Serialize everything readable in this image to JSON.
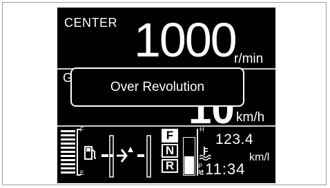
{
  "display": {
    "mode_label": "CENTER",
    "rpm_value": "1000",
    "rpm_unit": "r/min",
    "obscured_label_char": "G",
    "speed_value": "10",
    "speed_unit": "km/h",
    "fuel_full_label": "F",
    "fuel_empty_label": "E",
    "temp_hot_label": "H",
    "temp_cold_label": "C",
    "fuel_economy_value": "123.4",
    "fuel_economy_unit": "km/l",
    "clock_am": "A",
    "clock_pm": "P",
    "clock_m": "M",
    "clock_time": "11:34",
    "gears": [
      {
        "label": "F",
        "active": true
      },
      {
        "label": "N",
        "active": false
      },
      {
        "label": "R",
        "active": false
      }
    ],
    "fuel_level_fraction": 1.0
  },
  "popup": {
    "message": "Over Revolution"
  },
  "icons": [
    "fuel-pump-icon",
    "shuttle-direction-icon",
    "coolant-temperature-icon"
  ],
  "colors": {
    "screen_background": "#000000",
    "text": "#ffffff",
    "page_background": "#ffffff"
  }
}
